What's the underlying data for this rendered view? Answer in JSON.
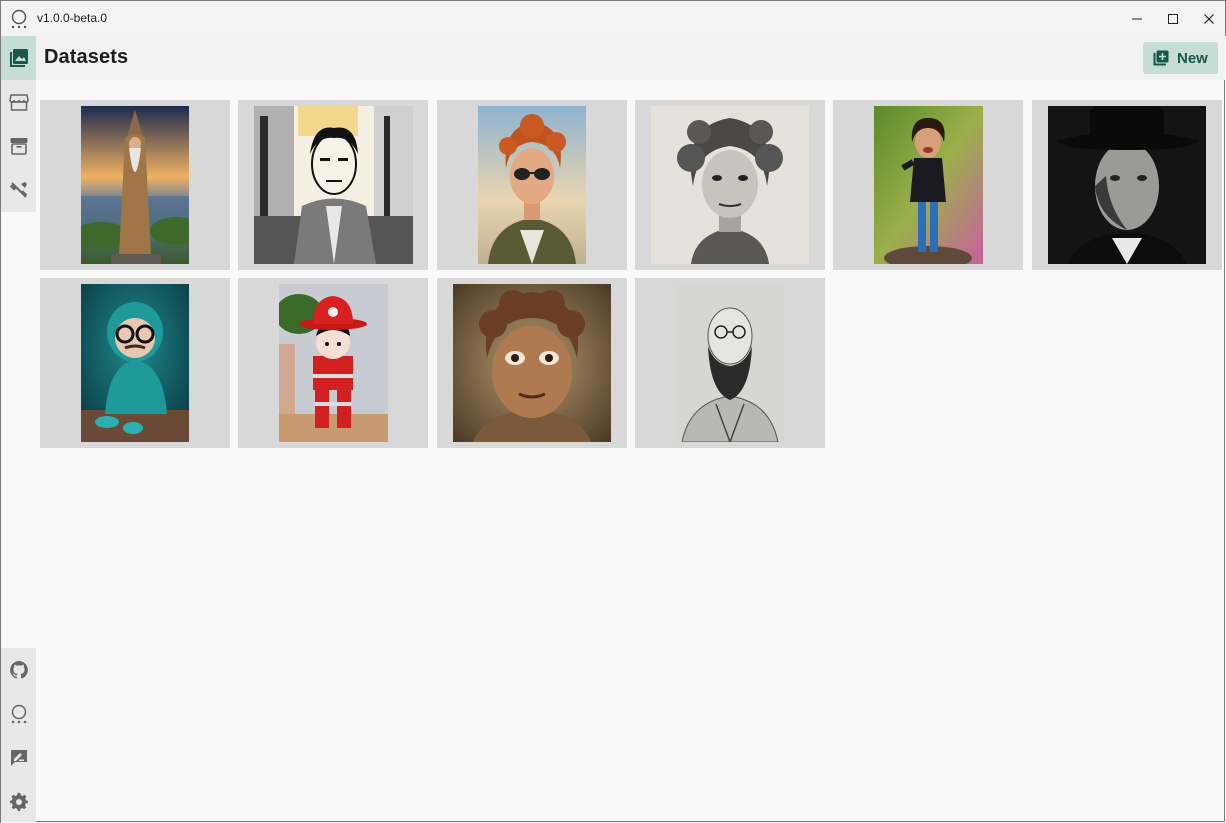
{
  "window": {
    "version": "v1.0.0-beta.0"
  },
  "header": {
    "title": "Datasets",
    "new_label": "New"
  },
  "sidebar": {
    "top_items": [
      {
        "icon": "image-gallery-icon",
        "active": true
      },
      {
        "icon": "store-icon",
        "active": false
      },
      {
        "icon": "archive-icon",
        "active": false
      },
      {
        "icon": "tools-icon",
        "active": false
      }
    ],
    "bottom_items": [
      {
        "icon": "github-icon"
      },
      {
        "icon": "app-logo-icon"
      },
      {
        "icon": "feedback-icon"
      },
      {
        "icon": "gear-icon"
      }
    ]
  },
  "datasets": [
    {
      "subject": "wizard"
    },
    {
      "subject": "comic-man"
    },
    {
      "subject": "redhead-sunglasses"
    },
    {
      "subject": "curly-sketch"
    },
    {
      "subject": "rockstar-figurine"
    },
    {
      "subject": "man-in-hat"
    },
    {
      "subject": "crochet-granny"
    },
    {
      "subject": "firefighter-doll"
    },
    {
      "subject": "clay-boy"
    },
    {
      "subject": "bearded-engraving"
    }
  ],
  "colors": {
    "accent": "#c6ddd5",
    "accent_text": "#18574a",
    "card_bg": "#d8d8d8"
  }
}
